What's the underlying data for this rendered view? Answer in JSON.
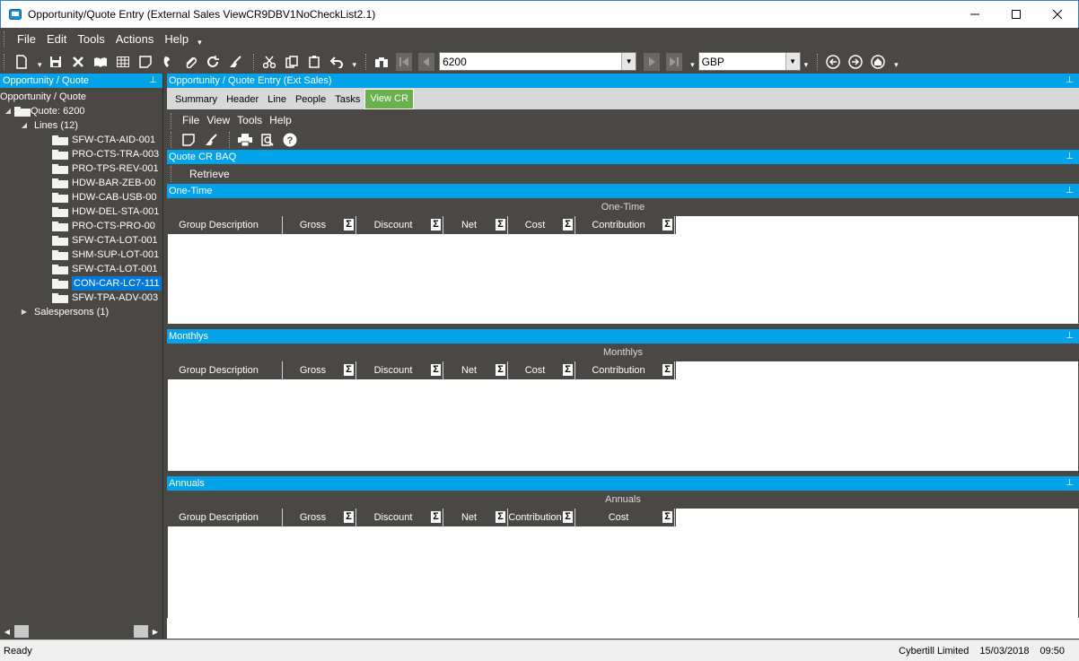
{
  "window": {
    "title": "Opportunity/Quote Entry (External Sales ViewCR9DBV1NoCheckList2.1)"
  },
  "menubar": {
    "items": [
      "File",
      "Edit",
      "Tools",
      "Actions",
      "Help"
    ]
  },
  "toolbar": {
    "quote_number": "6200",
    "currency": "GBP"
  },
  "left_panel": {
    "header": "Opportunity / Quote",
    "tree": {
      "root": "Opportunity / Quote",
      "quote": "Quote: 6200",
      "lines_label": "Lines (12)",
      "lines": [
        "SFW-CTA-AID-001",
        "PRO-CTS-TRA-003",
        "PRO-TPS-REV-001",
        "HDW-BAR-ZEB-00",
        "HDW-CAB-USB-00",
        "HDW-DEL-STA-001",
        "PRO-CTS-PRO-00",
        "SFW-CTA-LOT-001",
        "SHM-SUP-LOT-001",
        "SFW-CTA-LOT-001",
        "CON-CAR-LC7-111",
        "SFW-TPA-ADV-003"
      ],
      "selected_line": "CON-CAR-LC7-111",
      "salespersons_label": "Salespersons (1)"
    }
  },
  "right_panel": {
    "header": "Opportunity / Quote Entry (Ext Sales)",
    "tabs": [
      "Summary",
      "Header",
      "Line",
      "People",
      "Tasks",
      "View CR"
    ],
    "active_tab": "View CR",
    "inner_menu": [
      "File",
      "View",
      "Tools",
      "Help"
    ],
    "baq_header": "Quote CR BAQ",
    "retrieve_label": "Retrieve",
    "sections": [
      {
        "bar": "One-Time",
        "title": "One-Time",
        "columns": [
          "Group Description",
          "Gross",
          "Discount",
          "Net",
          "Cost",
          "Contribution"
        ]
      },
      {
        "bar": "Monthlys",
        "title": "Monthlys",
        "columns": [
          "Group Description",
          "Gross",
          "Discount",
          "Net",
          "Cost",
          "Contribution"
        ]
      },
      {
        "bar": "Annuals",
        "title": "Annuals",
        "columns": [
          "Group Description",
          "Gross",
          "Discount",
          "Net",
          "Contribution",
          "Cost"
        ]
      }
    ]
  },
  "statusbar": {
    "status": "Ready",
    "company": "Cybertill Limited",
    "date": "15/03/2018",
    "time": "09:50"
  },
  "colors": {
    "accent_blue": "#00a2e8",
    "dark_bg": "#4a4845",
    "active_tab_green": "#6ab04c",
    "selection_blue": "#0078d7"
  }
}
